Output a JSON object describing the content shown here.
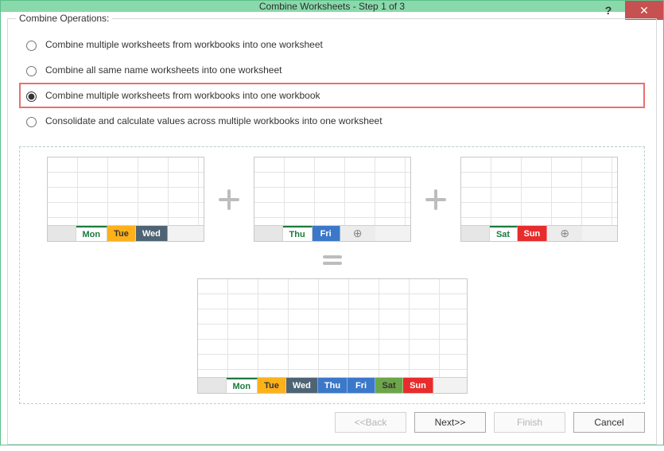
{
  "window": {
    "title": "Combine Worksheets - Step 1 of 3"
  },
  "group": {
    "title": "Combine Operations:",
    "options": [
      {
        "label": "Combine multiple worksheets from workbooks into one worksheet",
        "selected": false
      },
      {
        "label": "Combine all same name worksheets into one worksheet",
        "selected": false
      },
      {
        "label": "Combine multiple worksheets from workbooks into one workbook",
        "selected": true,
        "highlighted": true
      },
      {
        "label": "Consolidate and calculate values across multiple workbooks into one worksheet",
        "selected": false
      }
    ]
  },
  "preview": {
    "sources": [
      {
        "tabs": [
          {
            "label": "Mon",
            "style": "active"
          },
          {
            "label": "Tue",
            "style": "orange"
          },
          {
            "label": "Wed",
            "style": "gray"
          }
        ],
        "plus": false
      },
      {
        "tabs": [
          {
            "label": "Thu",
            "style": "active"
          },
          {
            "label": "Fri",
            "style": "blue"
          }
        ],
        "plus": true
      },
      {
        "tabs": [
          {
            "label": "Sat",
            "style": "active"
          },
          {
            "label": "Sun",
            "style": "red"
          }
        ],
        "plus": true
      }
    ],
    "result": {
      "tabs": [
        {
          "label": "Mon",
          "style": "active"
        },
        {
          "label": "Tue",
          "style": "orange"
        },
        {
          "label": "Wed",
          "style": "gray"
        },
        {
          "label": "Thu",
          "style": "blue"
        },
        {
          "label": "Fri",
          "style": "blue"
        },
        {
          "label": "Sat",
          "style": "green"
        },
        {
          "label": "Sun",
          "style": "red"
        }
      ]
    }
  },
  "buttons": {
    "back": "<<Back",
    "next": "Next>>",
    "finish": "Finish",
    "cancel": "Cancel"
  },
  "icons": {
    "plus_tab_glyph": "⊕",
    "close_glyph": "✕",
    "help_glyph": "?"
  }
}
